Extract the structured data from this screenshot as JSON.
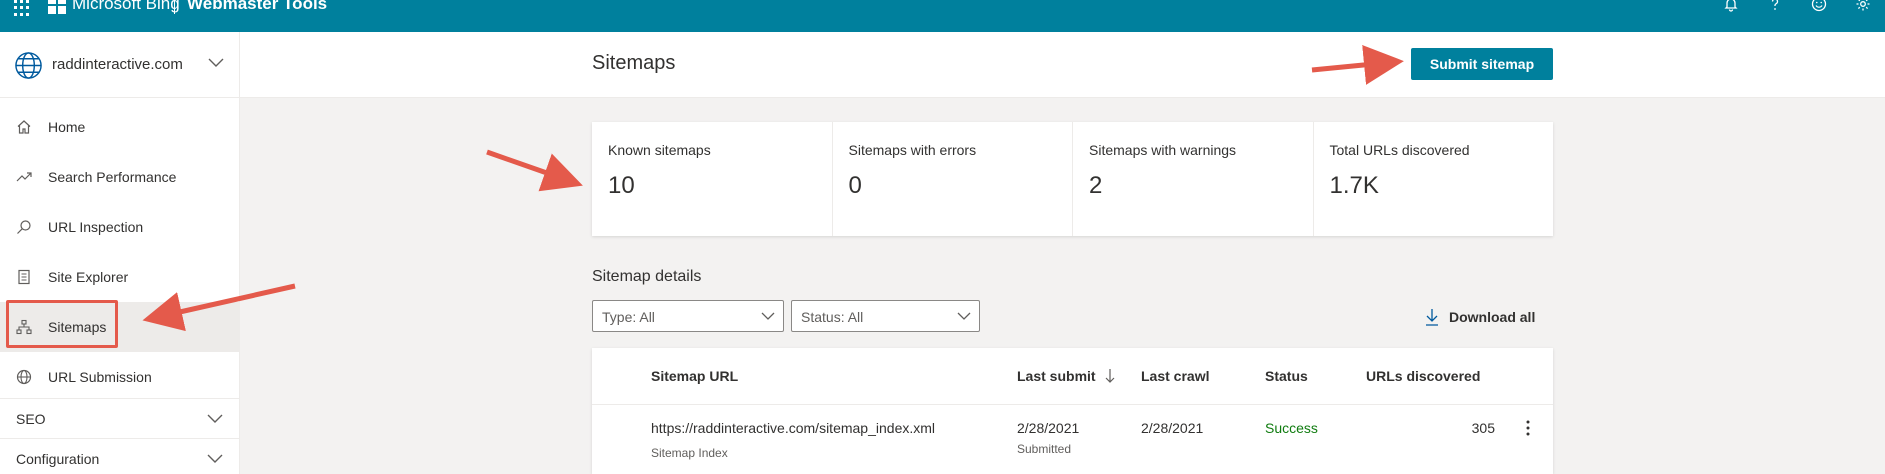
{
  "topbar": {
    "brand": "Microsoft Bing",
    "product": "Webmaster Tools",
    "icons": [
      "bell-icon",
      "help-icon",
      "smiley-icon",
      "gear-icon"
    ]
  },
  "sidebar": {
    "site": "raddinteractive.com",
    "items": [
      {
        "label": "Home",
        "icon": "home-icon"
      },
      {
        "label": "Search Performance",
        "icon": "trend-icon"
      },
      {
        "label": "URL Inspection",
        "icon": "search-icon"
      },
      {
        "label": "Site Explorer",
        "icon": "document-icon"
      },
      {
        "label": "Sitemaps",
        "icon": "sitemap-icon",
        "active": true
      },
      {
        "label": "URL Submission",
        "icon": "globe-icon"
      }
    ],
    "groups": [
      {
        "label": "SEO"
      },
      {
        "label": "Configuration"
      }
    ]
  },
  "header": {
    "title": "Sitemaps",
    "submit_label": "Submit sitemap"
  },
  "stats": [
    {
      "label": "Known sitemaps",
      "value": "10"
    },
    {
      "label": "Sitemaps with errors",
      "value": "0"
    },
    {
      "label": "Sitemaps with warnings",
      "value": "2"
    },
    {
      "label": "Total URLs discovered",
      "value": "1.7K"
    }
  ],
  "details": {
    "title": "Sitemap details",
    "type_filter": "Type: All",
    "status_filter": "Status: All",
    "download_label": "Download all"
  },
  "table": {
    "columns": [
      "Sitemap URL",
      "Last submit",
      "Last crawl",
      "Status",
      "URLs discovered"
    ],
    "rows": [
      {
        "url": "https://raddinteractive.com/sitemap_index.xml",
        "type": "Sitemap Index",
        "last_submit": "2/28/2021",
        "submit_note": "Submitted",
        "last_crawl": "2/28/2021",
        "status": "Success",
        "urls": "305"
      }
    ]
  },
  "colors": {
    "brand": "#00809d",
    "success": "#107c10",
    "annotation": "#e45a4b"
  }
}
